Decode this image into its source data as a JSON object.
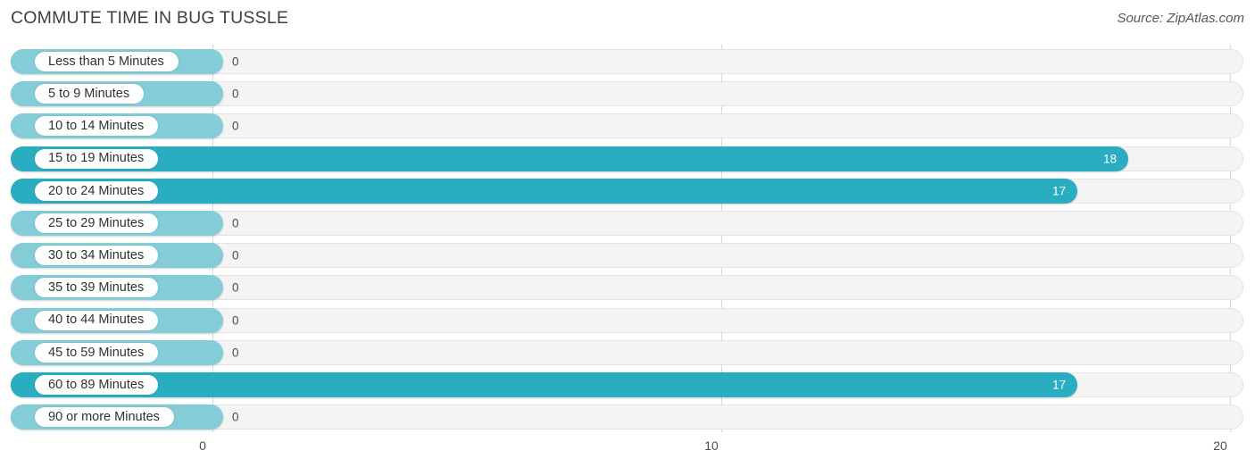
{
  "header": {
    "title": "COMMUTE TIME IN BUG TUSSLE",
    "source": "Source: ZipAtlas.com"
  },
  "colors": {
    "bar_filled": "#2badc1",
    "bar_zero": "#84cdd8",
    "track": "#f4f4f4",
    "gridline": "#d8d8d8",
    "title_text": "#3c4043"
  },
  "chart_data": {
    "type": "bar",
    "orientation": "horizontal",
    "title": "COMMUTE TIME IN BUG TUSSLE",
    "xlabel": "",
    "ylabel": "",
    "xlim": [
      0,
      20
    ],
    "xticks": [
      "0",
      "10",
      "20"
    ],
    "xtick_values": [
      0,
      10,
      20
    ],
    "grid": true,
    "legend": null,
    "categories": [
      "Less than 5 Minutes",
      "5 to 9 Minutes",
      "10 to 14 Minutes",
      "15 to 19 Minutes",
      "20 to 24 Minutes",
      "25 to 29 Minutes",
      "30 to 34 Minutes",
      "35 to 39 Minutes",
      "40 to 44 Minutes",
      "45 to 59 Minutes",
      "60 to 89 Minutes",
      "90 or more Minutes"
    ],
    "values": [
      0,
      0,
      0,
      18,
      17,
      0,
      0,
      0,
      0,
      0,
      17,
      0
    ],
    "value_labels": [
      "0",
      "0",
      "0",
      "18",
      "17",
      "0",
      "0",
      "0",
      "0",
      "0",
      "17",
      "0"
    ]
  },
  "rows": [
    {
      "label": "Less than 5 Minutes",
      "value": 0,
      "value_label": "0"
    },
    {
      "label": "5 to 9 Minutes",
      "value": 0,
      "value_label": "0"
    },
    {
      "label": "10 to 14 Minutes",
      "value": 0,
      "value_label": "0"
    },
    {
      "label": "15 to 19 Minutes",
      "value": 18,
      "value_label": "18"
    },
    {
      "label": "20 to 24 Minutes",
      "value": 17,
      "value_label": "17"
    },
    {
      "label": "25 to 29 Minutes",
      "value": 0,
      "value_label": "0"
    },
    {
      "label": "30 to 34 Minutes",
      "value": 0,
      "value_label": "0"
    },
    {
      "label": "35 to 39 Minutes",
      "value": 0,
      "value_label": "0"
    },
    {
      "label": "40 to 44 Minutes",
      "value": 0,
      "value_label": "0"
    },
    {
      "label": "45 to 59 Minutes",
      "value": 0,
      "value_label": "0"
    },
    {
      "label": "60 to 89 Minutes",
      "value": 17,
      "value_label": "17"
    },
    {
      "label": "90 or more Minutes",
      "value": 0,
      "value_label": "0"
    }
  ],
  "axis": {
    "ticks": [
      {
        "label": "0",
        "value": 0
      },
      {
        "label": "10",
        "value": 10
      },
      {
        "label": "20",
        "value": 20
      }
    ]
  }
}
